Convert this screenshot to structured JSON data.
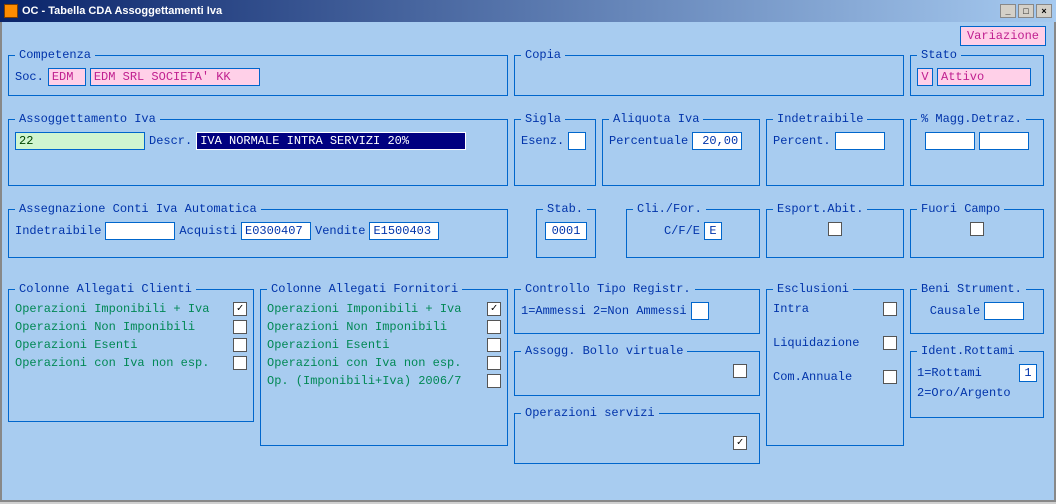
{
  "title": "OC - Tabella CDA Assoggettamenti Iva",
  "topRight": "Variazione",
  "competenza": {
    "legend": "Competenza",
    "socLabel": "Soc.",
    "socCode": "EDM",
    "socDesc": "EDM SRL SOCIETA' KK"
  },
  "copia": {
    "legend": "Copia"
  },
  "stato": {
    "legend": "Stato",
    "flag": "V",
    "value": "Attivo"
  },
  "assogg": {
    "legend": "Assoggettamento Iva",
    "code": "22",
    "descrLabel": "Descr.",
    "descr": "IVA NORMALE INTRA SERVIZI 20%"
  },
  "sigla": {
    "legend": "Sigla",
    "esenLabel": "Esenz."
  },
  "aliquota": {
    "legend": "Aliquota Iva",
    "percLabel": "Percentuale",
    "percValue": "20,00"
  },
  "indetr": {
    "legend": "Indetraibile",
    "percLabel": "Percent."
  },
  "maggDetr": {
    "legend": "% Magg.Detraz."
  },
  "assegn": {
    "legend": "Assegnazione Conti Iva Automatica",
    "indetrLabel": "Indetraibile",
    "acqLabel": "Acquisti",
    "acqVal": "E0300407",
    "venLabel": "Vendite",
    "venVal": "E1500403"
  },
  "stab": {
    "legend": "Stab.",
    "value": "0001"
  },
  "clifor": {
    "legend": "Cli./For.",
    "label": "C/F/E",
    "value": "E"
  },
  "esportAbit": {
    "legend": "Esport.Abit."
  },
  "fuoriCampo": {
    "legend": "Fuori Campo"
  },
  "colClienti": {
    "legend": "Colonne Allegati Clienti",
    "items": [
      {
        "label": "Operazioni Imponibili + Iva",
        "checked": true
      },
      {
        "label": "Operazioni Non Imponibili",
        "checked": false
      },
      {
        "label": "Operazioni Esenti",
        "checked": false
      },
      {
        "label": "Operazioni con Iva non esp.",
        "checked": false
      }
    ]
  },
  "colFornitori": {
    "legend": "Colonne Allegati Fornitori",
    "items": [
      {
        "label": "Operazioni Imponibili + Iva",
        "checked": true
      },
      {
        "label": "Operazioni Non Imponibili",
        "checked": false
      },
      {
        "label": "Operazioni Esenti",
        "checked": false
      },
      {
        "label": "Operazioni con Iva non esp.",
        "checked": false
      },
      {
        "label": "Op. (Imponibili+Iva) 2006/7",
        "checked": false
      }
    ]
  },
  "controllo": {
    "legend": "Controllo Tipo Registr.",
    "hint": "1=Ammessi 2=Non Ammessi"
  },
  "bollo": {
    "legend": "Assogg. Bollo virtuale"
  },
  "opServizi": {
    "legend": "Operazioni servizi",
    "checked": true
  },
  "esclusioni": {
    "legend": "Esclusioni",
    "items": [
      {
        "label": "Intra",
        "checked": false
      },
      {
        "label": "Liquidazione",
        "checked": false
      },
      {
        "label": "Com.Annuale",
        "checked": false
      }
    ]
  },
  "beniStrum": {
    "legend": "Beni Strument.",
    "label": "Causale"
  },
  "rottami": {
    "legend": "Ident.Rottami",
    "row1": "1=Rottami",
    "row1val": "1",
    "row2": "2=Oro/Argento"
  }
}
